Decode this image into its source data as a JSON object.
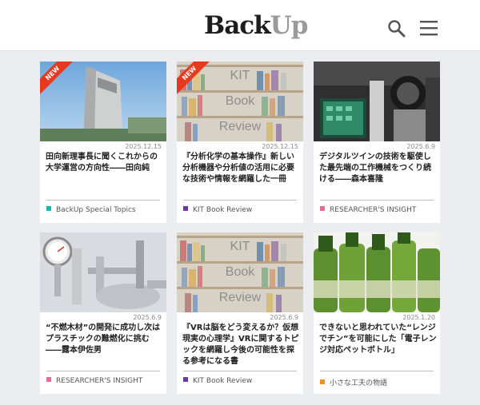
{
  "header": {
    "logo_part1": "Back",
    "logo_part2": "Up"
  },
  "cards": [
    {
      "badge": "NEW",
      "date": "2025.12.15",
      "title": "田向新理事長に聞くこれからの大学運営の方向性――田向純",
      "category": "BackUp Special Topics",
      "category_color": "#1bb5ad"
    },
    {
      "badge": "NEW",
      "image_text": [
        "KIT",
        "Book",
        "Review"
      ],
      "date": "2025.12.15",
      "title": "『分析化学の基本操作』新しい分析機器や分析値の活用に必要な技術や情報を網羅した一冊",
      "category": "KIT Book Review",
      "category_color": "#6a3aa8"
    },
    {
      "date": "2025.6.9",
      "title": "デジタルツインの技術を駆使した最先端の工作機械をつくり続ける――森本喜隆",
      "category": "RESEARCHER'S INSIGHT",
      "category_color": "#e86a98"
    },
    {
      "date": "2025.6.9",
      "title": "“不燃木材”の開発に成功し次はプラスチックの難燃化に挑む――露本伊佐男",
      "category": "RESEARCHER'S INSIGHT",
      "category_color": "#e86a98"
    },
    {
      "image_text": [
        "KIT",
        "Book",
        "Review"
      ],
      "date": "2025.6.9",
      "title": "『VRは脳をどう変えるか？仮想現実の心理学』VRに関するトピックを網羅し今後の可能性を探る参考になる書",
      "category": "KIT Book Review",
      "category_color": "#6a3aa8"
    },
    {
      "date": "2025.1.20",
      "title": "できないと思われていた“レンジでチン”を可能にした「電子レンジ対応ペットボトル」",
      "category": "小さな工夫の物語",
      "category_color": "#f0901e"
    }
  ]
}
